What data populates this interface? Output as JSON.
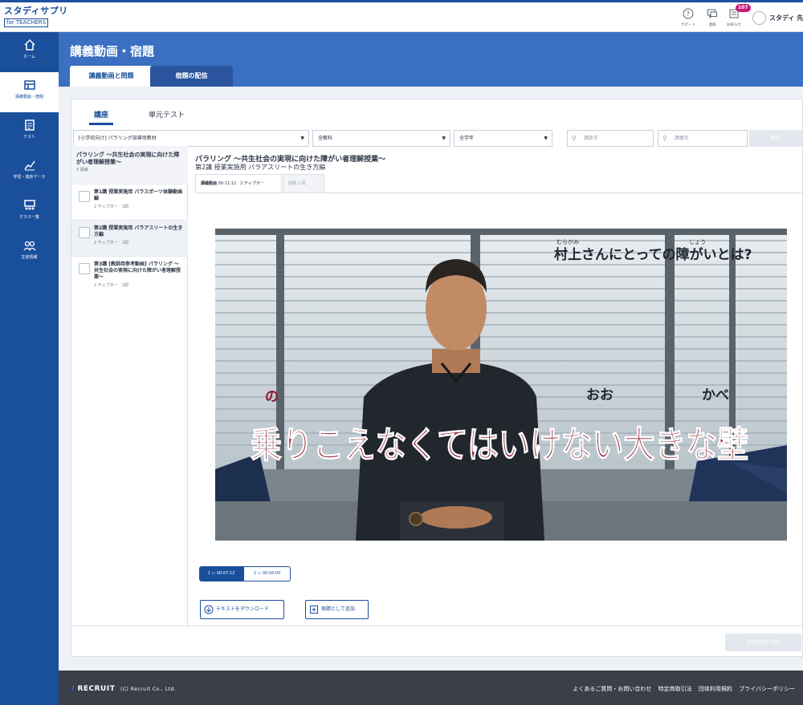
{
  "app": {
    "logo": "スタディサプリ",
    "logo_sub": "for TEACHERS"
  },
  "topbar": {
    "support": "サポート",
    "contact": "連絡",
    "notice": "お知らせ",
    "notice_count": "107",
    "user": "スタディ 先生"
  },
  "sidebar": {
    "items": [
      {
        "label": "ホーム",
        "icon": "home-icon"
      },
      {
        "label": "講義動画・宿題",
        "icon": "video-icon"
      },
      {
        "label": "テスト",
        "icon": "test-icon"
      },
      {
        "label": "学習・進捗データ",
        "icon": "chart-icon"
      },
      {
        "label": "クラス一覧",
        "icon": "class-icon"
      },
      {
        "label": "生徒情報",
        "icon": "students-icon"
      }
    ]
  },
  "page": {
    "title": "講義動画・宿題",
    "tabs": [
      "講義動画と問題",
      "宿題の配信"
    ]
  },
  "subtabs": [
    "講座",
    "単元テスト"
  ],
  "filters": {
    "course": "[小学校向け] パラリング指導用教材",
    "subject": "全教科",
    "grade": "全学年",
    "course_search": "講座名",
    "lecture_search": "講義名",
    "search_button": "検索"
  },
  "course": {
    "title": "パラリング 〜共生社会の実現に向けた障がい者理解授業〜",
    "count": "3 講義"
  },
  "lessons": [
    {
      "title": "第1講 授業実施用 パラスポーツ体験動画編",
      "meta": "2 チャプター　1問"
    },
    {
      "title": "第2講 授業実施用 パラアスリートの生き方編",
      "meta": "2 チャプター　1問"
    },
    {
      "title": "第3講 [教師用参考動画] パラリング 〜共生社会の実現に向けた障がい者理解授業〜",
      "meta": "2 チャプター　1問"
    }
  ],
  "detail": {
    "title": "パラリング 〜共生社会の実現に向けた障がい者理解授業〜",
    "subtitle": "第2講 授業実施用 パラアスリートの生き方編",
    "tab_video": "講義動画",
    "tab_video_meta": "00:11:12　2 チャプター",
    "tab_question": "問題",
    "tab_question_meta": "1 問"
  },
  "video": {
    "caption_furigana1": "むらかみ",
    "caption_furigana2": "しょう",
    "caption_top": "村上さんにとっての障がいとは?",
    "ruby_no": "の",
    "ruby_oo": "おお",
    "ruby_kabe": "かべ",
    "caption_bottom": "乗りこえなくてはいけない大きな壁"
  },
  "chapters": [
    {
      "num": "1",
      "time": "00:07:12"
    },
    {
      "num": "2",
      "time": "00:04:00"
    }
  ],
  "actions": {
    "download": "テキストをダウンロード",
    "add": "宿題として追加"
  },
  "next_button": "宿題の設定へ進む",
  "footer": {
    "brand": "RECRUIT",
    "copyright": "(C) Recruit Co., Ltd.",
    "links": [
      "よくあるご質問・お問い合わせ",
      "特定商取引法",
      "団体利用規約",
      "プライバシーポリシー"
    ]
  },
  "colors": {
    "primary": "#1a4f9c",
    "header": "#3a6fc1",
    "badge": "#c61c7b",
    "caption_red": "#8b1a2b"
  }
}
